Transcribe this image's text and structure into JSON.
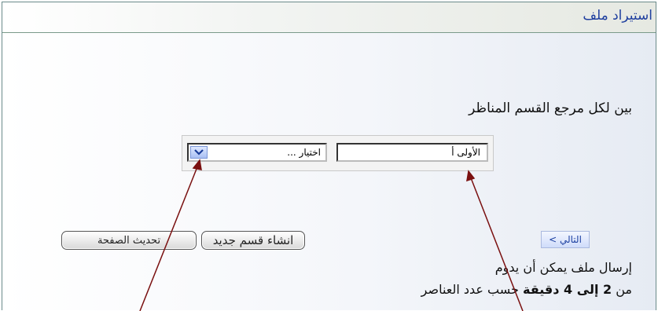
{
  "header": {
    "title": "استيراد ملف"
  },
  "instructions": "بين لكل مرجع القسم المناظر",
  "mapping": {
    "text_value": "الأولى أ",
    "select_value": "اختيار ..."
  },
  "buttons": {
    "new_section": "انشاء قسم جديد",
    "refresh": "تحديث الصفحة",
    "next": "التالي >"
  },
  "notes": {
    "line1": "إرسال ملف يمكن أن يدوم",
    "line2_prefix": "من",
    "line2_bold": "2 إلى 4 دقيقة",
    "line2_suffix": "حسب عدد العناصر"
  },
  "colors": {
    "title": "#1f3f9f",
    "next_button": "#cfdcfa",
    "arrow": "#7a1010"
  }
}
